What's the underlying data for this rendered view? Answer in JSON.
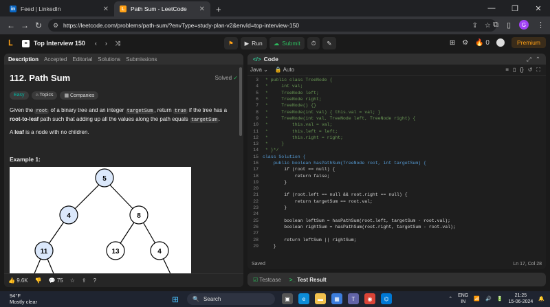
{
  "browser": {
    "tabs": [
      {
        "label": "Feed | LinkedIn",
        "icon": "linkedin-icon"
      },
      {
        "label": "Path Sum - LeetCode",
        "icon": "leetcode-icon"
      }
    ],
    "url": "https://leetcode.com/problems/path-sum/?envType=study-plan-v2&envId=top-interview-150"
  },
  "lc": {
    "list_name": "Top Interview 150",
    "run": "Run",
    "submit": "Submit",
    "streak": "0",
    "premium": "Premium"
  },
  "left": {
    "tabs": [
      "Description",
      "Accepted",
      "Editorial",
      "Solutions",
      "Submissions"
    ],
    "title": "112. Path Sum",
    "status": "Solved",
    "tags": [
      "Easy",
      "Topics",
      "Companies"
    ],
    "desc": {
      "p1a": "Given the",
      "root": "root",
      "p1b": "of a binary tree and an integer",
      "target": "targetSum",
      "p1c": ", return",
      "true": "true",
      "p1d": "if the tree has a",
      "p1e": "root-to-leaf",
      "p1f": "path such that adding up all the values along the path equals",
      "p2a": "A",
      "p2b": "leaf",
      "p2c": "is a node with no children."
    },
    "example": "Example 1:",
    "nodes": [
      "5",
      "4",
      "8",
      "11",
      "13",
      "4"
    ],
    "likes": "9.6K",
    "comments": "75"
  },
  "right": {
    "header": "Code",
    "language": "Java",
    "mode": "Auto",
    "code": [
      {
        "n": "3",
        "t": " * public class TreeNode {"
      },
      {
        "n": "4",
        "t": " *     int val;"
      },
      {
        "n": "5",
        "t": " *     TreeNode left;"
      },
      {
        "n": "6",
        "t": " *     TreeNode right;"
      },
      {
        "n": "7",
        "t": " *     TreeNode() {}"
      },
      {
        "n": "8",
        "t": " *     TreeNode(int val) { this.val = val; }"
      },
      {
        "n": "9",
        "t": " *     TreeNode(int val, TreeNode left, TreeNode right) {"
      },
      {
        "n": "10",
        "t": " *         this.val = val;"
      },
      {
        "n": "11",
        "t": " *         this.left = left;"
      },
      {
        "n": "12",
        "t": " *         this.right = right;"
      },
      {
        "n": "13",
        "t": " *     }"
      },
      {
        "n": "14",
        "t": " * }*/"
      },
      {
        "n": "15",
        "t": "class Solution {"
      },
      {
        "n": "16",
        "t": "    public boolean hasPathSum(TreeNode root, int targetSum) {"
      },
      {
        "n": "17",
        "t": "        if (root == null) {"
      },
      {
        "n": "18",
        "t": "            return false;"
      },
      {
        "n": "19",
        "t": "        }"
      },
      {
        "n": "20",
        "t": ""
      },
      {
        "n": "21",
        "t": "        if (root.left == null && root.right == null) {"
      },
      {
        "n": "22",
        "t": "            return targetSum == root.val;"
      },
      {
        "n": "23",
        "t": "        }"
      },
      {
        "n": "24",
        "t": ""
      },
      {
        "n": "25",
        "t": "        boolean leftSum = hasPathSum(root.left, targetSum - root.val);"
      },
      {
        "n": "26",
        "t": "        boolean rightSum = hasPathSum(root.right, targetSum - root.val);"
      },
      {
        "n": "27",
        "t": ""
      },
      {
        "n": "28",
        "t": "        return leftSum || rightSum;"
      },
      {
        "n": "29",
        "t": "    }"
      }
    ],
    "saved": "Saved",
    "position": "Ln 17, Col 28",
    "testcase": "Testcase",
    "result": "Test Result"
  },
  "taskbar": {
    "temp": "94°F",
    "weather": "Mostly clear",
    "search": "Search",
    "lang1": "ENG",
    "lang2": "IN",
    "time": "21:25",
    "date": "15-06-2024"
  }
}
